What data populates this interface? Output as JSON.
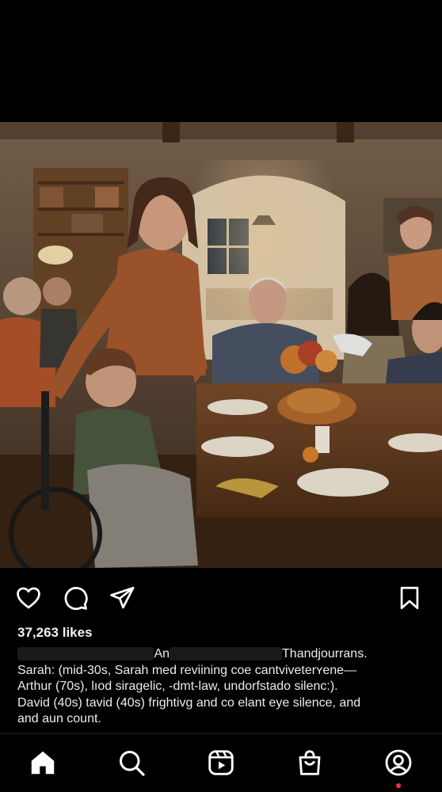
{
  "post": {
    "likes_text": "37,263 likes",
    "caption": {
      "line1_mid": "An",
      "line1_end": "Thandjourrans.",
      "line2": "Sarah: (mid-30s, Sarah med reviining coe cantviveterʏene—",
      "line3": "Arthur (70s), lıod siragelic, -dmt-law, undorfstado silenc:).",
      "line4": "David (40s) tavid (40s) frightivg and co elant eye silence, and",
      "line5": "and aun count."
    }
  },
  "actions": {
    "like_icon": "heart-icon",
    "comment_icon": "comment-icon",
    "share_icon": "send-icon",
    "save_icon": "bookmark-icon"
  },
  "nav": {
    "items": [
      "home-icon",
      "search-icon",
      "reels-icon",
      "shop-icon",
      "profile-icon"
    ],
    "notification_color": "#ff2d46"
  },
  "colors": {
    "background": "#000000",
    "text": "#ffffff"
  }
}
